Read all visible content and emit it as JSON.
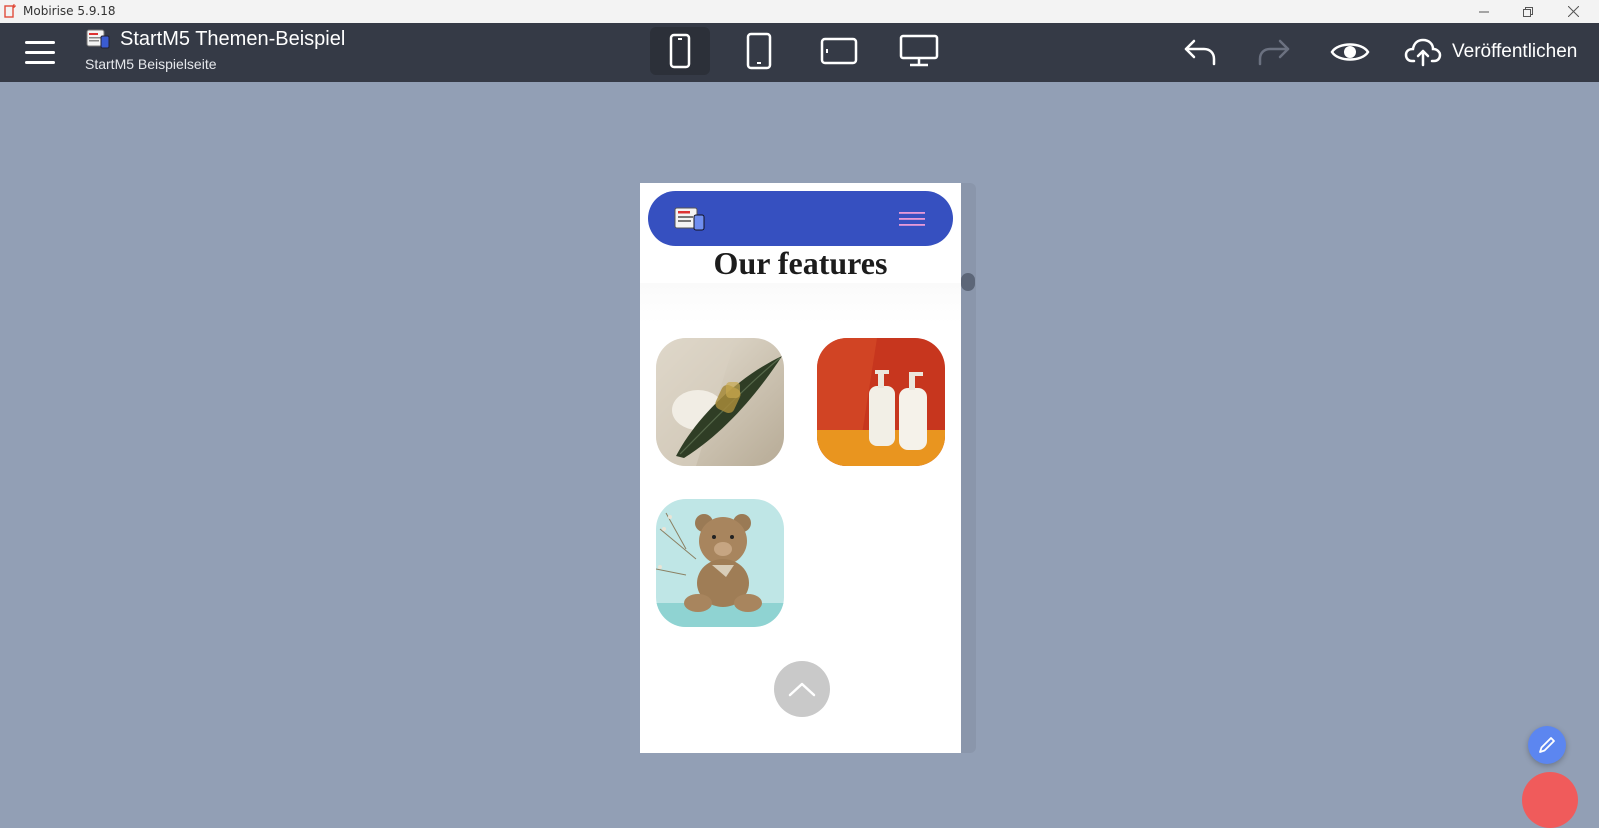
{
  "window": {
    "title": "Mobirise 5.9.18"
  },
  "toolbar": {
    "project_title": "StartM5 Themen-Beispiel",
    "project_subtitle": "StartM5 Beispielseite",
    "devices": [
      "phone",
      "tablet-portrait",
      "tablet-landscape",
      "desktop"
    ],
    "active_device": "phone",
    "publish_label": "Veröffentlichen"
  },
  "preview": {
    "section_title": "Our features",
    "nav_color": "#3650c0"
  },
  "colors": {
    "workspace": "#929fb5",
    "toolbar": "#353a46",
    "fab_edit": "#5c86f0",
    "fab_add": "#f05b5b"
  }
}
